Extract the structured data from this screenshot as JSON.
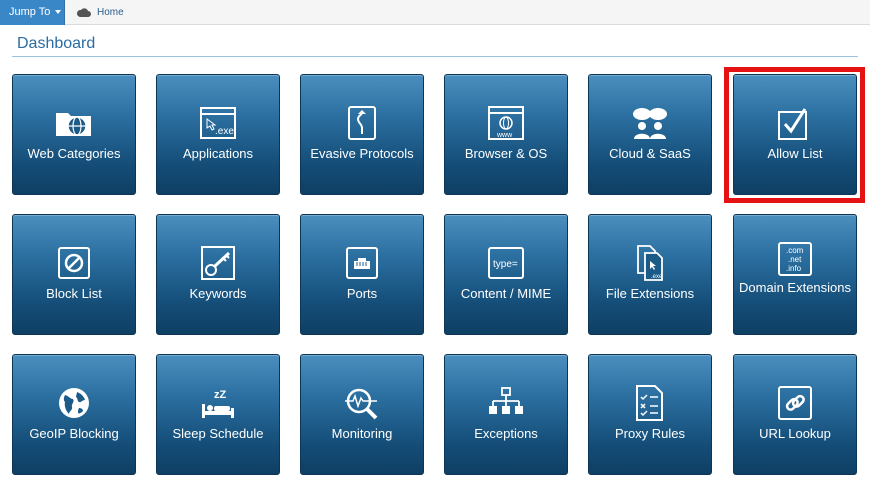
{
  "topbar": {
    "jump_label": "Jump To",
    "home_label": "Home"
  },
  "page": {
    "title": "Dashboard"
  },
  "tiles": [
    {
      "label": "Web Categories",
      "icon": "folder-globe-icon"
    },
    {
      "label": "Applications",
      "icon": "exe-window-icon"
    },
    {
      "label": "Evasive Protocols",
      "icon": "evasive-arrow-icon"
    },
    {
      "label": "Browser & OS",
      "icon": "browser-www-icon"
    },
    {
      "label": "Cloud & SaaS",
      "icon": "cloud-users-icon"
    },
    {
      "label": "Allow List",
      "icon": "checkbox-icon"
    },
    {
      "label": "Block List",
      "icon": "block-icon"
    },
    {
      "label": "Keywords",
      "icon": "key-icon"
    },
    {
      "label": "Ports",
      "icon": "port-icon"
    },
    {
      "label": "Content / MIME",
      "icon": "type-icon"
    },
    {
      "label": "File Extensions",
      "icon": "file-exe-icon"
    },
    {
      "label": "Domain Extensions",
      "icon": "domain-ext-icon",
      "icon_text": [
        ".com",
        ".net",
        ".info"
      ]
    },
    {
      "label": "GeoIP Blocking",
      "icon": "globe-icon"
    },
    {
      "label": "Sleep Schedule",
      "icon": "sleep-icon"
    },
    {
      "label": "Monitoring",
      "icon": "monitor-magnifier-icon"
    },
    {
      "label": "Exceptions",
      "icon": "exceptions-tree-icon"
    },
    {
      "label": "Proxy Rules",
      "icon": "checklist-icon"
    },
    {
      "label": "URL Lookup",
      "icon": "link-icon"
    }
  ],
  "icon_text": {
    "exe": ".exe",
    "type": "type=",
    "www": "www",
    "z": "zZ"
  },
  "colors": {
    "accent": "#3a87c8",
    "tile_top": "#4a8fbe",
    "tile_bottom": "#0f3f64",
    "highlight": "#e41212"
  }
}
